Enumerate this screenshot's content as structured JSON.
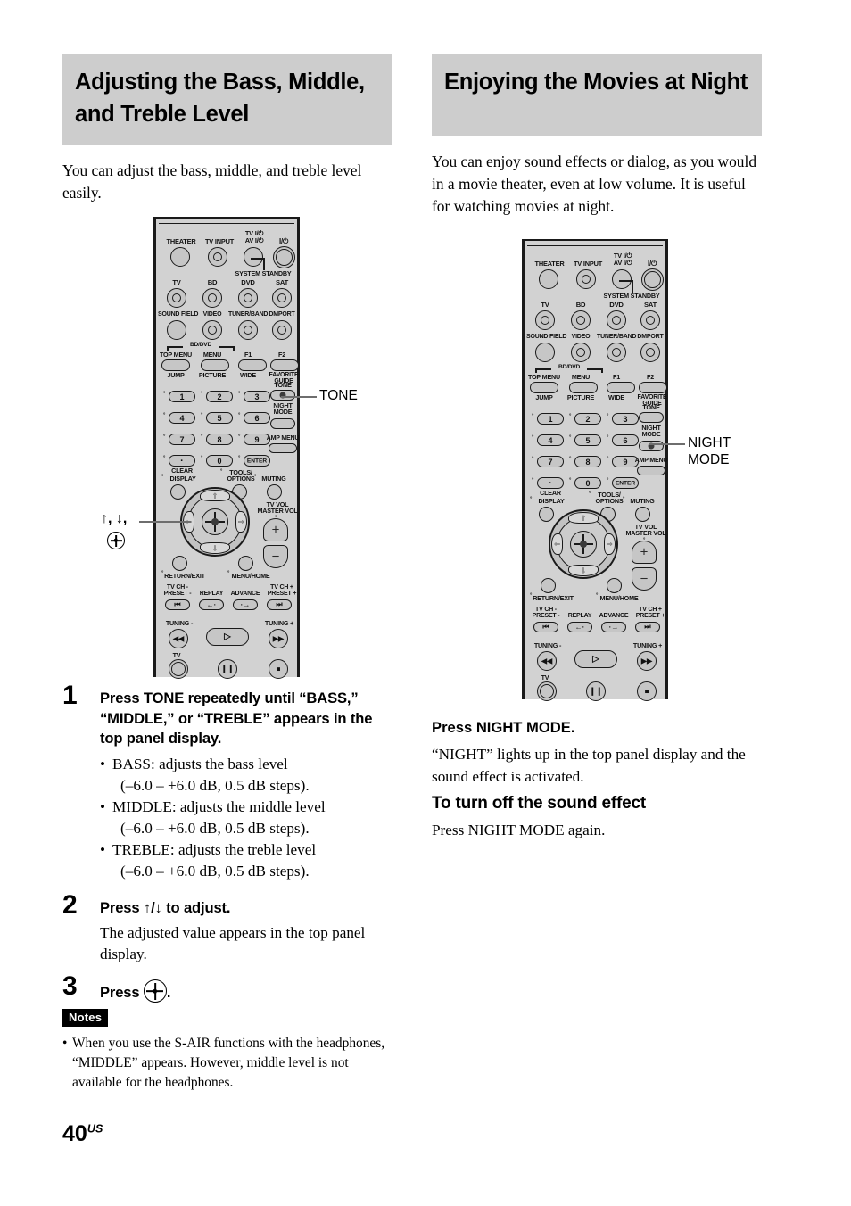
{
  "page": {
    "number": "40",
    "region_suffix": "US"
  },
  "left_column": {
    "heading": "Adjusting the Bass, Middle, and Treble Level",
    "intro": "You can adjust the bass, middle, and treble level easily.",
    "callouts": {
      "tone": "TONE",
      "updown": "↑, ↓,"
    },
    "steps": [
      {
        "number": "1",
        "title": "Press TONE repeatedly until “BASS,” “MIDDLE,” or “TREBLE” appears in the top panel display.",
        "bullets": [
          {
            "main": "BASS: adjusts the bass level",
            "sub": "(–6.0 – +6.0 dB, 0.5 dB steps)."
          },
          {
            "main": "MIDDLE: adjusts the middle level",
            "sub": "(–6.0 – +6.0 dB, 0.5 dB steps)."
          },
          {
            "main": "TREBLE: adjusts the treble level",
            "sub": "(–6.0 – +6.0 dB, 0.5 dB steps)."
          }
        ]
      },
      {
        "number": "2",
        "title": "Press ↑/↓ to adjust.",
        "description": "The adjusted value appears in the top panel display."
      },
      {
        "number": "3",
        "title_prefix": "Press ",
        "title_suffix": "."
      }
    ],
    "notes": {
      "badge": "Notes",
      "items": [
        "When you use the S-AIR functions with the headphones, “MIDDLE” appears. However, middle level is not available for the headphones."
      ]
    }
  },
  "right_column": {
    "heading": "Enjoying the Movies at Night",
    "intro": "You can enjoy sound effects or dialog, as you would in a movie theater, even at low volume. It is useful for watching movies at night.",
    "callouts": {
      "night_mode": "NIGHT\nMODE"
    },
    "instruction": "Press NIGHT MODE.",
    "instruction_detail": "“NIGHT” lights up in the top panel display and the sound effect is activated.",
    "subheading": "To turn off the sound effect",
    "subheading_text": "Press NIGHT MODE again."
  },
  "remote": {
    "rows": {
      "row1_labels": [
        "THEATER",
        "TV INPUT",
        "TV I/⏻\nAV I/⏻",
        "I/⏻"
      ],
      "system_standby": "SYSTEM STANDBY",
      "row2_labels": [
        "TV",
        "BD",
        "DVD",
        "SAT"
      ],
      "row3_labels": [
        "SOUND FIELD",
        "VIDEO",
        "TUNER/BAND",
        "DMPORT"
      ],
      "bddvd_bracket": "BD/DVD",
      "row4_top_labels": [
        "TOP MENU",
        "MENU",
        "F1",
        "F2"
      ],
      "row4_bottom_labels": [
        "JUMP",
        "PICTURE",
        "WIDE",
        "FAVORITE\nGUIDE"
      ],
      "numbers": [
        "1",
        "2",
        "3",
        "4",
        "5",
        "6",
        "7",
        "8",
        "9",
        "0"
      ],
      "clear_label": "CLEAR",
      "enter_label": "ENTER",
      "tone_label": "TONE",
      "night_mode_label": "NIGHT\nMODE",
      "amp_menu_label": "AMP MENU",
      "display_label": "DISPLAY",
      "tools_options_label": "TOOLS/\nOPTIONS",
      "muting_label": "MUTING",
      "tv_vol_label": "TV VOL\nMASTER VOL",
      "return_exit_label": "RETURN/EXIT",
      "menu_home_label": "MENU/HOME",
      "tv_ch_minus_label": "TV CH -\nPRESET -",
      "replay_label": "REPLAY",
      "advance_label": "ADVANCE",
      "tv_ch_plus_label": "TV CH +\nPRESET +",
      "tuning_minus_label": "TUNING -",
      "tuning_plus_label": "TUNING +",
      "tv_label": "TV"
    }
  }
}
